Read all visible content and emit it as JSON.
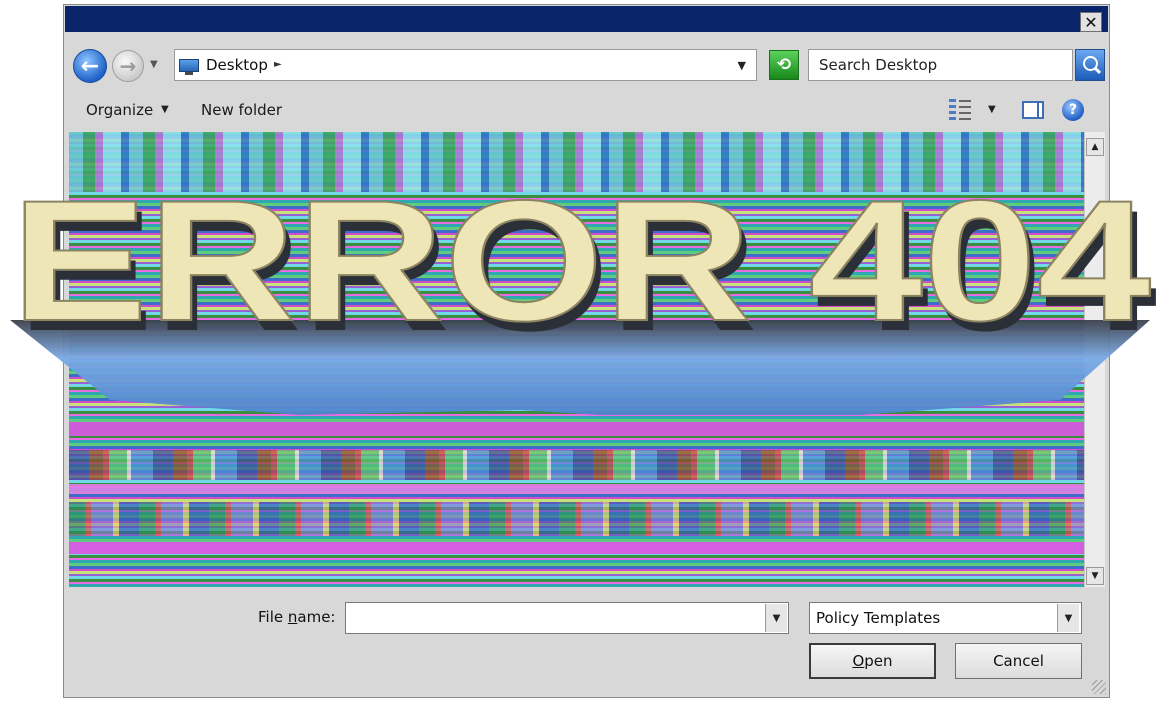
{
  "window": {
    "close_glyph": "✕"
  },
  "nav": {
    "back_glyph": "←",
    "forward_glyph": "→",
    "history_dropdown_glyph": "▼"
  },
  "address_bar": {
    "location": "Desktop",
    "crumb_arrow": "►",
    "dropdown_glyph": "▼",
    "refresh_glyph": "⟲"
  },
  "search": {
    "placeholder": "Search Desktop"
  },
  "toolbar": {
    "organize_label": "Organize",
    "organize_arrow": "▼",
    "new_folder_label": "New folder",
    "views_arrow": "▼",
    "help_glyph": "?"
  },
  "overlay": {
    "text": "ERROR 404",
    "face_color": "#efe6b8",
    "extrusion_color": "#6fa0dc"
  },
  "scrollbar": {
    "up_glyph": "▲",
    "down_glyph": "▼"
  },
  "footer": {
    "file_name_label_pre": "File ",
    "file_name_label_accel": "n",
    "file_name_label_post": "ame:",
    "file_name_value": "",
    "file_name_dropdown_glyph": "▼",
    "file_type_value": "Policy Templates",
    "file_type_dropdown_glyph": "▼",
    "open_label_accel": "O",
    "open_label_rest": "pen",
    "cancel_label": "Cancel"
  },
  "colors": {
    "titlebar": "#0a246a",
    "dialog_bg": "#d8d8d8"
  }
}
